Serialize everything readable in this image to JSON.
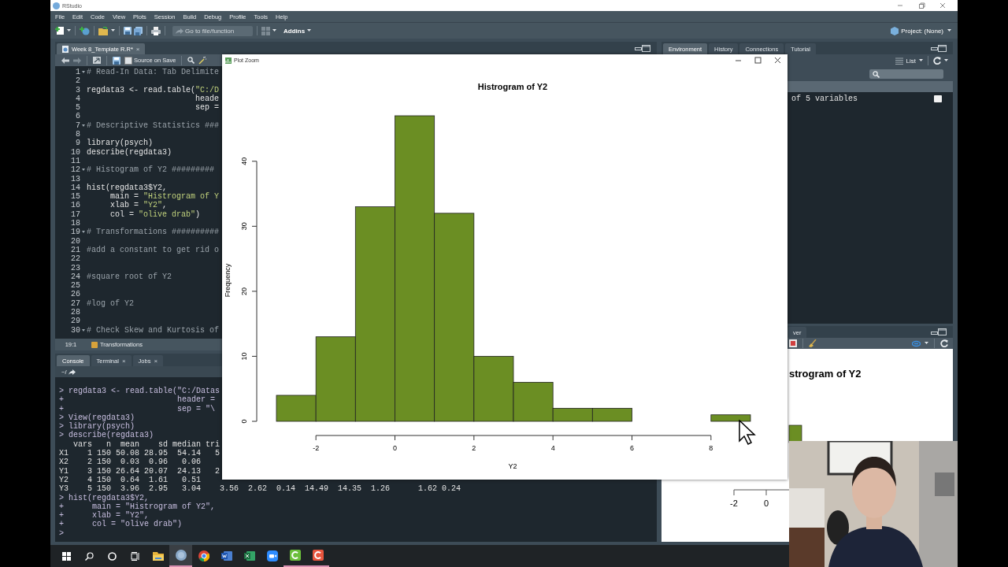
{
  "window": {
    "title": "RStudio"
  },
  "menu": [
    "File",
    "Edit",
    "Code",
    "View",
    "Plots",
    "Session",
    "Build",
    "Debug",
    "Profile",
    "Tools",
    "Help"
  ],
  "toolbar": {
    "goto_placeholder": "Go to file/function",
    "addins": "Addins",
    "project": "Project: (None)"
  },
  "editor": {
    "tab": {
      "label": "Week 8_Template R.R*",
      "close": "×"
    },
    "source_on_save": {
      "label": "Source on Save",
      "checked": false
    },
    "lines": [
      {
        "number": "1",
        "fold": true,
        "kind": "comment",
        "code": "# Read-In Data: Tab Delimite"
      },
      {
        "number": "2"
      },
      {
        "number": "3",
        "code": "regdata3 <- read.table(\"C:/D"
      },
      {
        "number": "4",
        "code": "                       heade"
      },
      {
        "number": "5",
        "code": "                       sep ="
      },
      {
        "number": "6"
      },
      {
        "number": "7",
        "fold": true,
        "kind": "comment",
        "code": "# Descriptive Statistics ###"
      },
      {
        "number": "8"
      },
      {
        "number": "9",
        "code": "library(psych)"
      },
      {
        "number": "10",
        "code": "describe(regdata3)"
      },
      {
        "number": "11"
      },
      {
        "number": "12",
        "fold": true,
        "kind": "comment",
        "code": "# Histogram of Y2 #########"
      },
      {
        "number": "13"
      },
      {
        "number": "14",
        "code": "hist(regdata3$Y2,"
      },
      {
        "number": "15",
        "code": "     main = \"Histrogram of Y"
      },
      {
        "number": "16",
        "code": "     xlab = \"Y2\","
      },
      {
        "number": "17",
        "code": "     col = \"olive drab\")"
      },
      {
        "number": "18"
      },
      {
        "number": "19",
        "fold": true,
        "kind": "comment",
        "code": "# Transformations ##########"
      },
      {
        "number": "20"
      },
      {
        "number": "21",
        "kind": "comment",
        "code": "#add a constant to get rid o"
      },
      {
        "number": "22"
      },
      {
        "number": "23"
      },
      {
        "number": "24",
        "kind": "comment",
        "code": "#square root of Y2"
      },
      {
        "number": "25"
      },
      {
        "number": "26"
      },
      {
        "number": "27",
        "kind": "comment",
        "code": "#log of Y2"
      },
      {
        "number": "28"
      },
      {
        "number": "29"
      },
      {
        "number": "30",
        "fold": true,
        "kind": "comment",
        "code": "# Check Skew and Kurtosis of"
      }
    ],
    "position": "19:1",
    "section": "Transformations"
  },
  "console": {
    "tabs": [
      {
        "label": "Console",
        "selected": true
      },
      {
        "label": "Terminal",
        "close": "×",
        "selected": false
      },
      {
        "label": "Jobs",
        "close": "×",
        "selected": false
      }
    ],
    "path": "~/",
    "lines": [
      {
        "kind": "input",
        "text": "> regdata3 <- read.table(\"C:/Datas"
      },
      {
        "kind": "input",
        "text": "+                        header ="
      },
      {
        "kind": "input",
        "text": "+                        sep = \"\\"
      },
      {
        "kind": "input",
        "text": "> View(regdata3)"
      },
      {
        "kind": "input",
        "text": "> library(psych)"
      },
      {
        "kind": "input",
        "text": "> describe(regdata3)"
      },
      {
        "kind": "output",
        "text": "   vars   n  mean    sd median tri"
      },
      {
        "kind": "output",
        "text": "X1    1 150 50.08 28.95  54.14   5"
      },
      {
        "kind": "output",
        "text": "X2    2 150  0.03  0.96   0.06"
      },
      {
        "kind": "output",
        "text": "Y1    3 150 26.64 20.07  24.13   2"
      },
      {
        "kind": "output",
        "text": "Y2    4 150  0.64  1.61   0.51"
      },
      {
        "kind": "output",
        "text": "Y3    5 150  3.96  2.95   3.04    3.56  2.62  0.14  14.49  14.35  1.26      1.62 0.24"
      },
      {
        "kind": "input",
        "text": "> hist(regdata3$Y2,"
      },
      {
        "kind": "input",
        "text": "+      main = \"Histrogram of Y2\","
      },
      {
        "kind": "input",
        "text": "+      xlab = \"Y2\","
      },
      {
        "kind": "input",
        "text": "+      col = \"olive drab\")"
      },
      {
        "kind": "input",
        "text": ">"
      }
    ]
  },
  "environment": {
    "tabs": [
      {
        "label": "Environment",
        "selected": true
      },
      {
        "label": "History",
        "selected": false
      },
      {
        "label": "Connections",
        "selected": false
      },
      {
        "label": "Tutorial",
        "selected": false
      }
    ],
    "view": "List",
    "summary": "of 5 variables"
  },
  "viewer": {
    "tab": "ver",
    "plot_title": "strogram of Y2",
    "ticks": [
      "-2",
      "0"
    ]
  },
  "plot_zoom": {
    "title": "Plot Zoom",
    "chart_data": {
      "type": "bar",
      "title": "Histrogram of Y2",
      "xlabel": "Y2",
      "ylabel": "Frequency",
      "x": [
        -2.5,
        -1.5,
        -0.5,
        0.5,
        1.5,
        2.5,
        3.5,
        4.5,
        5.5,
        6.5,
        7.5,
        8.5
      ],
      "values": [
        4,
        13,
        33,
        47,
        32,
        10,
        6,
        2,
        2,
        0,
        0,
        1
      ],
      "xlim": [
        -3,
        9
      ],
      "ylim": [
        0,
        47
      ],
      "xticks": [
        -2,
        0,
        2,
        4,
        6,
        8
      ],
      "yticks": [
        0,
        10,
        20,
        30,
        40
      ]
    }
  },
  "webcam": {
    "kind": "picture"
  },
  "taskbar": {
    "apps": [
      {
        "kind": "files",
        "active": false,
        "running": false
      },
      {
        "kind": "r",
        "active": true,
        "running": true
      },
      {
        "kind": "chrome",
        "active": false,
        "running": false
      },
      {
        "kind": "word",
        "active": false,
        "running": false
      },
      {
        "kind": "excel",
        "active": false,
        "running": false
      },
      {
        "kind": "zoom",
        "active": false,
        "running": false
      },
      {
        "kind": "recorder-green",
        "active": false,
        "running": true
      },
      {
        "kind": "recorder-red",
        "active": false,
        "running": true
      }
    ]
  }
}
